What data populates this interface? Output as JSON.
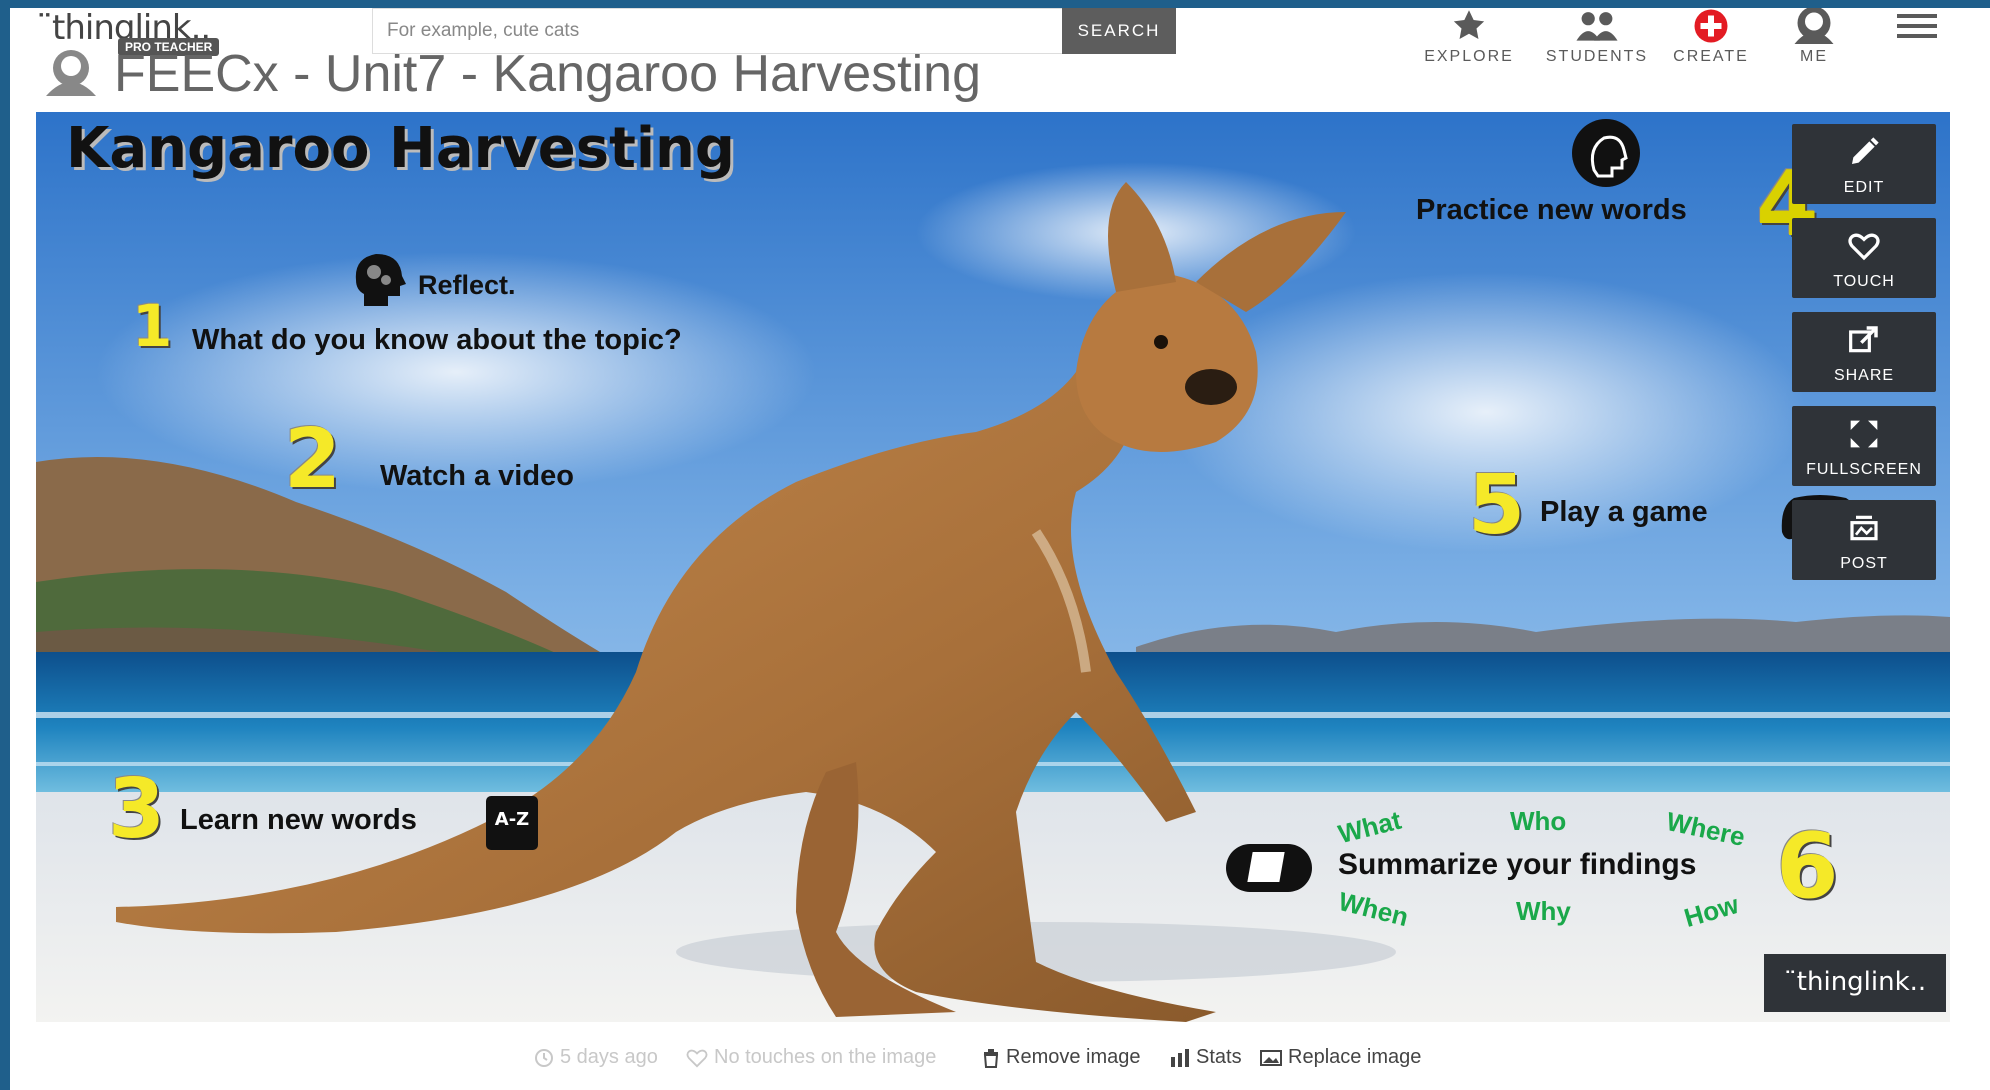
{
  "header": {
    "logo_text": "¨thinglink..",
    "logo_badge": "PRO TEACHER",
    "page_title": "FEECx - Unit7 - Kangaroo Harvesting",
    "search": {
      "placeholder": "For example, cute cats",
      "button_label": "SEARCH"
    },
    "nav": [
      {
        "label": "EXPLORE",
        "icon": "star-icon"
      },
      {
        "label": "STUDENTS",
        "icon": "students-icon"
      },
      {
        "label": "CREATE",
        "icon": "plus-circle-icon"
      },
      {
        "label": "ME",
        "icon": "user-icon"
      },
      {
        "label": "",
        "icon": "hamburger-menu-icon"
      }
    ]
  },
  "image": {
    "heading": "Kangaroo Harvesting",
    "steps": [
      {
        "number": "1",
        "pre": "Reflect.",
        "text": "What do you know about the topic?",
        "icon": "brain-gears-icon"
      },
      {
        "number": "2",
        "text": "Watch a video"
      },
      {
        "number": "3",
        "text": "Learn new words",
        "icon": "dictionary-az-icon"
      },
      {
        "number": "4",
        "text": "Practice new words",
        "icon": "head-thinking-icon"
      },
      {
        "number": "5",
        "text": "Play a game",
        "icon": "gamepad-icon"
      },
      {
        "number": "6",
        "text": "Summarize your findings",
        "icon": "notes-icon"
      }
    ],
    "question_words": [
      "What",
      "Who",
      "Where",
      "When",
      "Why",
      "How"
    ],
    "side_buttons": [
      {
        "label": "EDIT",
        "icon": "pencil-icon"
      },
      {
        "label": "TOUCH",
        "icon": "heart-icon"
      },
      {
        "label": "SHARE",
        "icon": "share-icon"
      },
      {
        "label": "FULLSCREEN",
        "icon": "fullscreen-icon"
      },
      {
        "label": "POST",
        "icon": "post-icon"
      }
    ],
    "watermark": "¨thinglink.."
  },
  "footer": {
    "time": "5 days ago",
    "touches": "No touches on the image",
    "remove": "Remove image",
    "stats": "Stats",
    "replace": "Replace image"
  },
  "colors": {
    "step_number": "#f5e928",
    "question_green": "#1aa84a",
    "panel": "#2f3338",
    "frame": "#1f5f8b"
  }
}
